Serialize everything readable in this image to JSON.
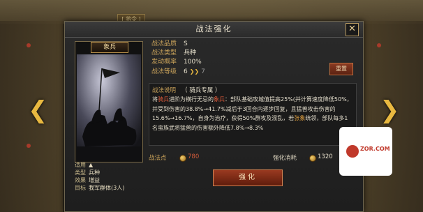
{
  "background": {
    "header_tag": "[ 将令 ]"
  },
  "nav": {
    "prev_arrow": "❮",
    "next_arrow": "❯"
  },
  "modal": {
    "title": "战法强化",
    "close_label": "✕"
  },
  "card": {
    "name": "象兵",
    "icon": "cavalry-art"
  },
  "info": [
    {
      "k": "适用",
      "v": "▲"
    },
    {
      "k": "类型",
      "v": "兵种"
    },
    {
      "k": "效果",
      "v": "增益"
    },
    {
      "k": "目标",
      "v": "我军群体(3人)"
    }
  ],
  "attributes": [
    {
      "k": "战法品质",
      "v": "S",
      "next": ""
    },
    {
      "k": "战法类型",
      "v": "兵种",
      "next": ""
    },
    {
      "k": "发动概率",
      "v": "100%",
      "next": ""
    },
    {
      "k": "战法等级",
      "v": "6",
      "next": "7"
    }
  ],
  "reset_label": "重置",
  "description": {
    "label": "战法说明",
    "tag": "（ 骑兵专属 ）",
    "seg1": "将",
    "seg2": "骑兵",
    "seg3": "进阶为横行无忌的",
    "seg4": "象兵",
    "seg5": "：部队基础攻城值提高25%(并计算速度降低50%，并受到伤害的38.8%→41.7%减后于3回合内逐步回复，且猛兽攻击伤害的15.6%→16.7%，自身为治疗，获得50%群攻及混乱，若",
    "seg6": "张",
    "seg7": "象",
    "seg8": "统领，部队每多1名蛮族武将猛兽的伤害额外降低7.8%→8.3%"
  },
  "points": {
    "label": "战法点",
    "value": "780"
  },
  "cost": {
    "label": "强化消耗",
    "value": "1320"
  },
  "strengthen_label": "强化",
  "watermark": {
    "text": "ZOR.COM"
  }
}
